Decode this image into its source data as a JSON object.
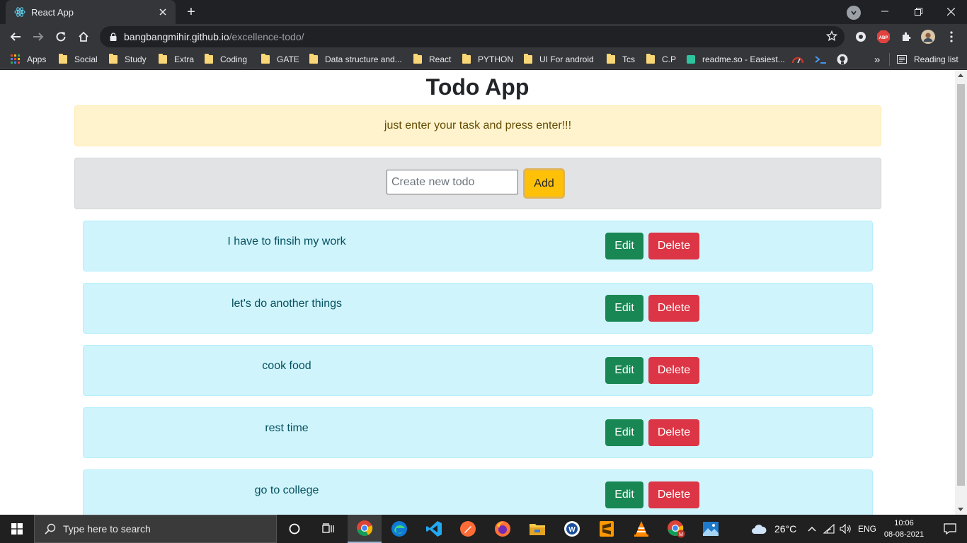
{
  "browser": {
    "tab_title": "React App",
    "new_tab_symbol": "+",
    "url_host": "bangbangmihir.github.io",
    "url_path": "/excellence-todo/",
    "ext_abp_label": "ABP",
    "bookmarks": {
      "apps": "Apps",
      "items": [
        "Social",
        "Study",
        "Extra",
        "Coding",
        "GATE",
        "Data structure and...",
        "React",
        "PYTHON",
        "UI For android",
        "Tcs",
        "C.P",
        "readme.so - Easiest..."
      ],
      "overflow": "»",
      "reading_list": "Reading list"
    }
  },
  "app": {
    "title": "Todo App",
    "alert": "just enter your task and press enter!!!",
    "input_placeholder": "Create new todo",
    "add_label": "Add",
    "edit_label": "Edit",
    "delete_label": "Delete",
    "todos": [
      "I have to finsih my work",
      "let's do another things",
      "cook food",
      "rest time",
      "go to college"
    ]
  },
  "taskbar": {
    "search_placeholder": "Type here to search",
    "weather": "26°C",
    "language": "ENG",
    "time": "10:06",
    "date": "08-08-2021"
  },
  "colors": {
    "warning": "#ffc107",
    "success": "#198754",
    "danger": "#dc3545",
    "info_bg": "#cff4fc"
  }
}
